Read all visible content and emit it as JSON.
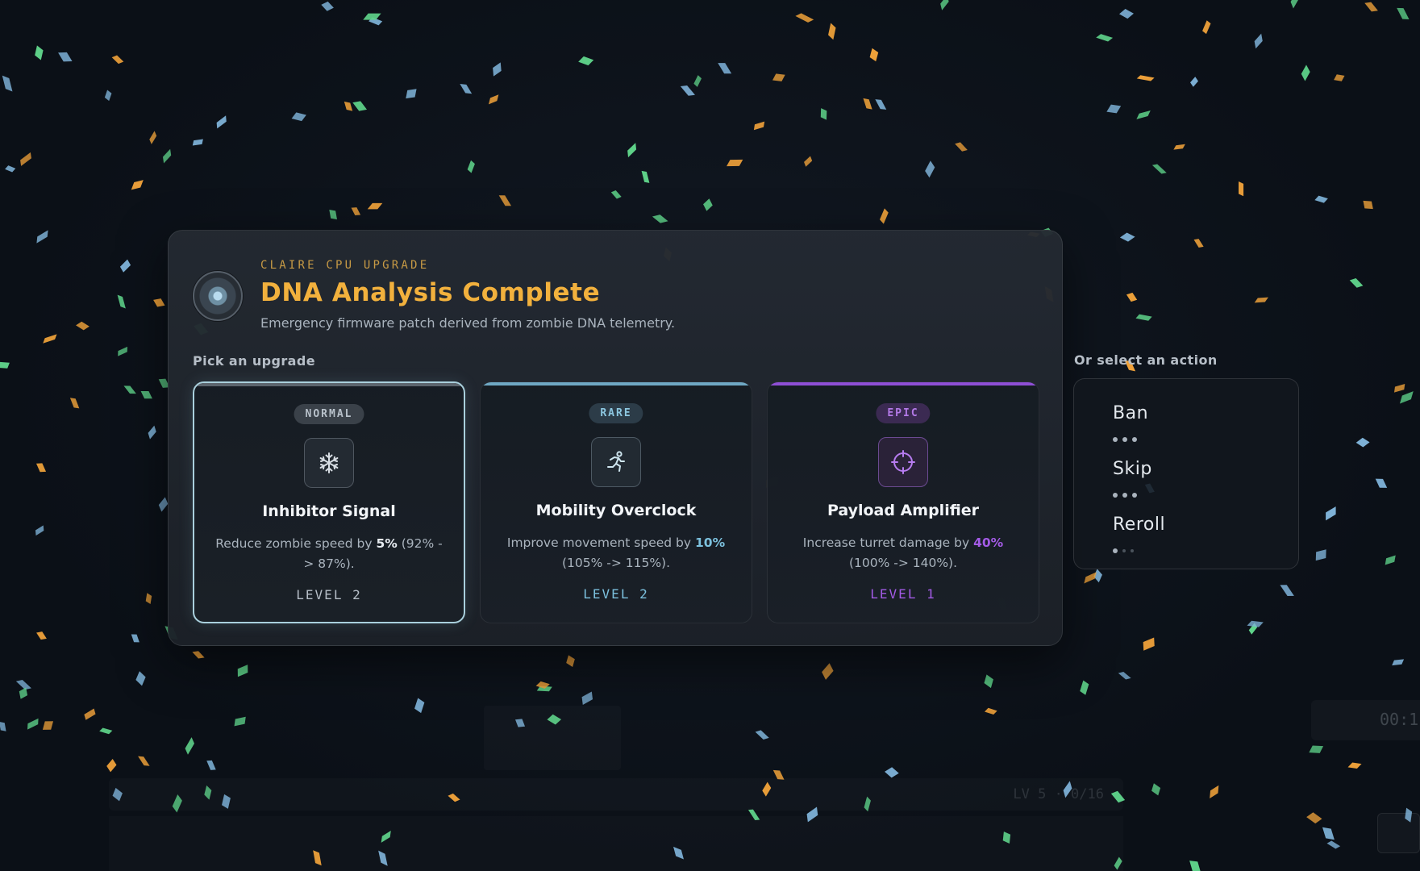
{
  "header": {
    "kicker": "CLAIRE CPU UPGRADE",
    "title": "DNA Analysis Complete",
    "subtitle": "Emergency firmware patch derived from zombie DNA telemetry."
  },
  "pick_label": "Pick an upgrade",
  "cards": [
    {
      "rarity": "NORMAL",
      "icon": "snowflake-icon",
      "name": "Inhibitor Signal",
      "desc_pre": "Reduce zombie speed by ",
      "desc_value": "5%",
      "desc_post": " (92% -> 87%).",
      "level": "LEVEL 2",
      "accent": "#aab3bd",
      "selected": true
    },
    {
      "rarity": "RARE",
      "icon": "running-figure-icon",
      "name": "Mobility Overclock",
      "desc_pre": "Improve movement speed by ",
      "desc_value": "10%",
      "desc_post": " (105% -> 115%).",
      "level": "LEVEL 2",
      "accent": "#7cc1de",
      "selected": false
    },
    {
      "rarity": "EPIC",
      "icon": "crosshair-icon",
      "name": "Payload Amplifier",
      "desc_pre": "Increase turret damage by ",
      "desc_value": "40%",
      "desc_post": " (100% -> 140%).",
      "level": "LEVEL 1",
      "accent": "#a35be6",
      "selected": false
    }
  ],
  "actions_label": "Or select an action",
  "actions": [
    {
      "label": "Ban",
      "remaining": 3,
      "total": 3
    },
    {
      "label": "Skip",
      "remaining": 3,
      "total": 3
    },
    {
      "label": "Reroll",
      "remaining": 1,
      "total": 3
    }
  ],
  "background_hud": {
    "timer": "00:1",
    "level_progress": "LV 5 · 0/16"
  },
  "colors": {
    "title": "#f2b13d",
    "kicker": "#c79a45",
    "confetti": [
      "#f0a23a",
      "#5fd38a",
      "#7fb3d9"
    ]
  }
}
